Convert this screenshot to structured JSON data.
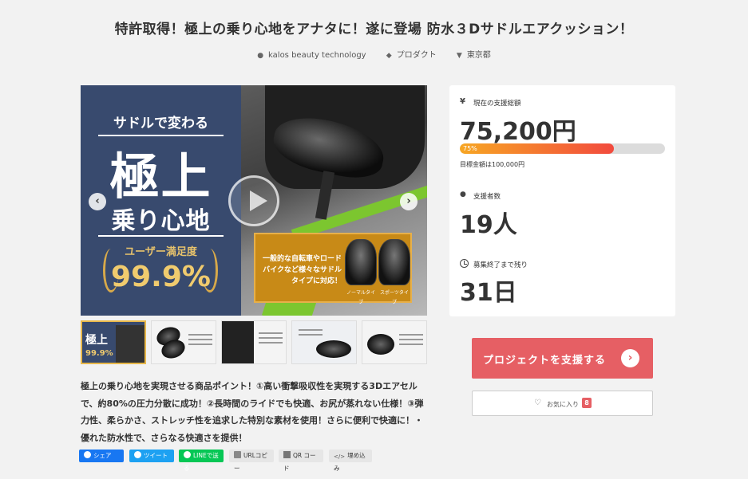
{
  "project": {
    "title": "特許取得！極上の乗り心地をアナタに！遂に登場 防水３Dサドルエアクッション！",
    "owner": "kalos beauty technology",
    "category": "プロダクト",
    "location": "東京都",
    "description": "極上の乗り心地を実現させる商品ポイント！①高い衝撃吸収性を実現する3Dエアセルで、約80%の圧力分散に成功！②長時間のライドでも快適、お尻が蒸れない仕様！③弾力性、柔らかさ、ストレッチ性を追求した特別な素材を使用！さらに便利で快適に！・優れた防水性で、さらなる快適さを提供！"
  },
  "hero": {
    "sub": "サドルで変わる",
    "big": "極上",
    "mid": "乗り心地",
    "satisfaction_label": "ユーザー満足度",
    "satisfaction_value": "99.9%",
    "callout": "一般的な自転車やロードバイクなど様々なサドルタイプに対応！",
    "type_normal": "ノーマルタイプ",
    "type_sport": "スポーツタイプ",
    "prev": "‹",
    "next": "›"
  },
  "thumbs": [
    {
      "title": "極上",
      "pct": "99.9%"
    },
    {
      "caption": ""
    },
    {
      "caption": ""
    },
    {
      "caption": ""
    },
    {
      "caption": ""
    }
  ],
  "stats": {
    "total_label": "現在の支援総額",
    "total_value": "75,200円",
    "progress_pct": 75,
    "progress_text": "75%",
    "goal_text": "目標金額は100,000円",
    "backers_label": "支援者数",
    "backers_value": "19人",
    "remaining_label": "募集終了まで残り",
    "remaining_value": "31日",
    "yen_icon": "¥"
  },
  "actions": {
    "support_label": "プロジェクトを支援する",
    "favorite_label": "お気に入り",
    "favorite_count": "8"
  },
  "share": {
    "facebook": "シェア",
    "twitter": "ツイート",
    "line": "LINEで送る",
    "url_copy": "URLコピー",
    "qr": "QR コード",
    "embed": "埋め込み"
  },
  "icons": [
    "user-icon",
    "tag-icon",
    "location-icon",
    "yen-icon",
    "backers-icon",
    "clock-icon",
    "heart-icon",
    "arrow-right-icon",
    "play-icon"
  ],
  "colors": {
    "accent": "#e65f64",
    "progress_start": "#f7a623",
    "progress_end": "#f24a3e"
  }
}
